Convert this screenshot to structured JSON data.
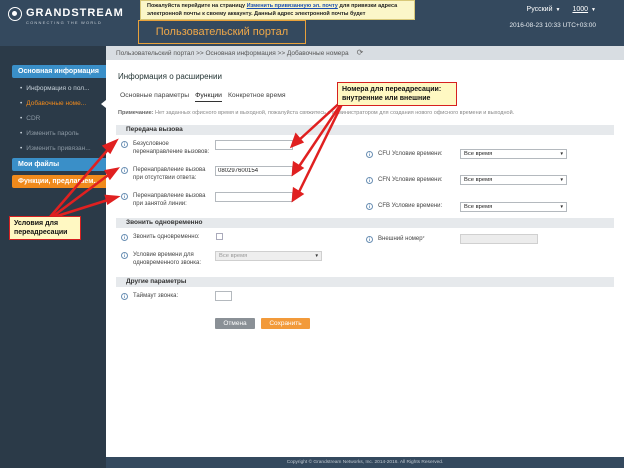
{
  "header": {
    "brand": "GRANDSTREAM",
    "tagline": "CONNECTING THE WORLD",
    "notice_pre": "Пожалуйста перейдите на страницу ",
    "notice_link": "Изменить привязанную эл. почту",
    "notice_post": " для привязки адреса электронной почты к своему аккаунту. Данный адрес электронной почты будет",
    "portal_title": "Пользовательский портал",
    "language": "Русский",
    "user": "1000",
    "datetime": "2016-08-23 10:33 UTC+03:00"
  },
  "sidebar": {
    "sections": [
      {
        "label": "Основная информация"
      },
      {
        "label": "Мои файлы"
      },
      {
        "label": "Функции, предлагаем..."
      }
    ],
    "items": [
      {
        "label": "Информация о пол..."
      },
      {
        "label": "Добавочные номе..."
      },
      {
        "label": "CDR"
      },
      {
        "label": "Изменить пароль"
      },
      {
        "label": "Изменить привязан..."
      }
    ]
  },
  "main": {
    "breadcrumb": "Пользовательский портал >> Основная информация >> Добавочные номера",
    "title": "Информация о расширении",
    "tabs": [
      {
        "label": "Основные параметры"
      },
      {
        "label": "Функции"
      },
      {
        "label": "Конкретное время"
      }
    ],
    "note_label": "Примечание:",
    "note_text": " Нет заданных офисного время и выходной, пожалуйста свяжитесь с администратором для создания нового офисного времени и выходной.",
    "sections": {
      "forward": "Передача вызова",
      "ring": "Звонить одновременно",
      "other": "Другие параметры"
    },
    "forward": {
      "cfu_label_1": "Безусловное",
      "cfu_label_2": "перенаправление вызовов:",
      "cfu_value": "",
      "cfn_label_1": "Перенаправление вызова",
      "cfn_label_2": "при отсутствии ответа:",
      "cfn_value": "080297600154",
      "cfb_label_1": "Перенаправление вызова",
      "cfb_label_2": "при занятой линии:",
      "cfb_value": "",
      "cfu_time_label": "CFU Условие времени:",
      "cfu_time": "Все время",
      "cfn_time_label": "CFN Условие времени:",
      "cfn_time": "Все время",
      "cfb_time_label": "CFB Условие времени:",
      "cfb_time": "Все время"
    },
    "ring": {
      "simul_label": "Звонить одновременно:",
      "external_label": "Внешний номер",
      "external_required": "*",
      "external_value": "",
      "time_label_1": "Условие времени для",
      "time_label_2": "одновременного звонка:",
      "time_value": "Все время"
    },
    "other": {
      "timeout_label": "Таймаут звонка:",
      "timeout_value": ""
    },
    "buttons": {
      "cancel": "Отмена",
      "save": "Сохранить"
    }
  },
  "callouts": {
    "numbers": "Номера для переадресации: внутренние или внешние",
    "conditions": "Условия для переадресации"
  },
  "footer": "Copyright © Grandstream Networks, Inc. 2014-2016. All Rights Reserved.",
  "colors": {
    "accent": "#f08a1c",
    "sidebar_active": "#3a8fc8",
    "callout_border": "#d62020",
    "header_bg": "#34495e"
  }
}
